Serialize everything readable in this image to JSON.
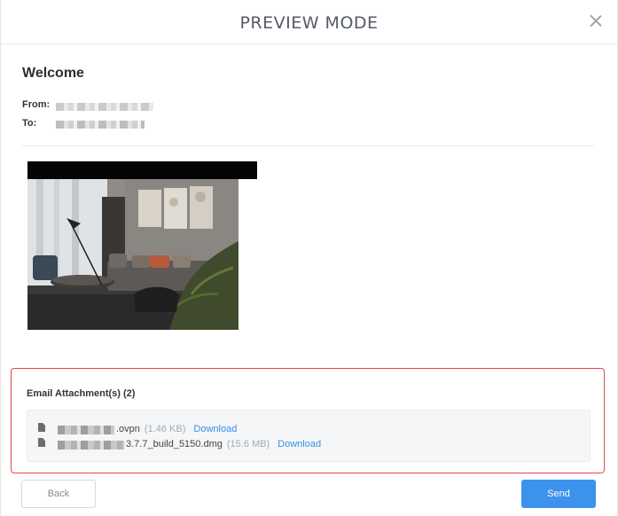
{
  "modal": {
    "title": "PREVIEW MODE",
    "close_icon": "close-icon"
  },
  "email": {
    "subject": "Welcome",
    "from_label": "From:",
    "to_label": "To:"
  },
  "attachments": {
    "title": "Email Attachment(s) (2)",
    "items": [
      {
        "name_suffix": ".ovpn",
        "size": "(1.46 KB)",
        "download_label": "Download",
        "icon": "file-icon"
      },
      {
        "name_suffix": "3.7.7_build_5150.dmg",
        "size": "(15.6 MB)",
        "download_label": "Download",
        "icon": "file-icon"
      }
    ]
  },
  "footer": {
    "back_label": "Back",
    "send_label": "Send"
  },
  "colors": {
    "accent": "#3d92ec",
    "highlight_border": "#e0484f",
    "link": "#3b8ee8"
  }
}
